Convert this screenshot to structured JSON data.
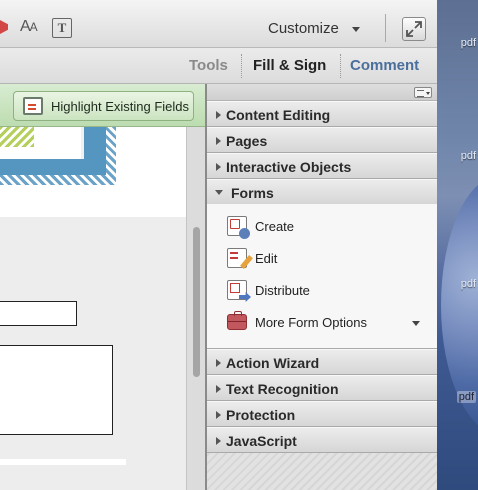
{
  "desktop": {
    "labels": [
      "pdf",
      "pdf",
      "pdf",
      "pdf"
    ]
  },
  "toolbar": {
    "customize_label": "Customize"
  },
  "tabs": [
    {
      "label": "Tools"
    },
    {
      "label": "Fill & Sign"
    },
    {
      "label": "Comment"
    }
  ],
  "doc": {
    "highlight_button_label": "Highlight Existing Fields"
  },
  "panel": {
    "sections_before": [
      {
        "label": "Content Editing",
        "expanded": false
      },
      {
        "label": "Pages",
        "expanded": false
      },
      {
        "label": "Interactive Objects",
        "expanded": false
      }
    ],
    "forms": {
      "label": "Forms",
      "expanded": true,
      "items": [
        {
          "label": "Create",
          "icon": "form-create-icon"
        },
        {
          "label": "Edit",
          "icon": "form-edit-icon"
        },
        {
          "label": "Distribute",
          "icon": "form-distribute-icon"
        },
        {
          "label": "More Form Options",
          "icon": "toolbox-icon"
        }
      ]
    },
    "sections_after": [
      {
        "label": "Action Wizard",
        "expanded": false
      },
      {
        "label": "Text Recognition",
        "expanded": false
      },
      {
        "label": "Protection",
        "expanded": false
      },
      {
        "label": "JavaScript",
        "expanded": false
      }
    ]
  },
  "colors": {
    "comment_tab": "#4a6f9c",
    "highlight_bar": "#bddcb0"
  }
}
